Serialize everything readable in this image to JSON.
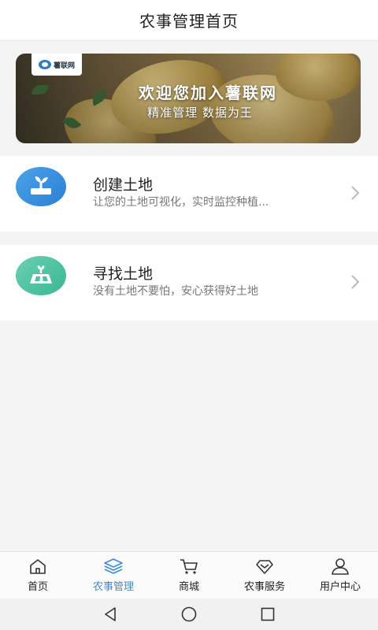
{
  "header": {
    "title": "农事管理首页"
  },
  "banner": {
    "logo_text": "薯联网",
    "title": "欢迎您加入薯联网",
    "subtitle": "精准管理  数据为王"
  },
  "cards": [
    {
      "title": "创建土地",
      "description": "让您的土地可视化，实时监控种植...",
      "icon": "plant-icon"
    },
    {
      "title": "寻找土地",
      "description": "没有土地不要怕，安心获得好土地",
      "icon": "field-icon"
    }
  ],
  "tabbar": {
    "active_index": 1,
    "active_color": "#3a8cd8",
    "items": [
      {
        "label": "首页",
        "icon": "home-icon"
      },
      {
        "label": "农事管理",
        "icon": "layers-icon"
      },
      {
        "label": "商城",
        "icon": "cart-icon"
      },
      {
        "label": "农事服务",
        "icon": "diamond-icon"
      },
      {
        "label": "用户中心",
        "icon": "user-icon"
      }
    ]
  },
  "system_nav": [
    "back-icon",
    "home-circle-icon",
    "recents-icon"
  ]
}
